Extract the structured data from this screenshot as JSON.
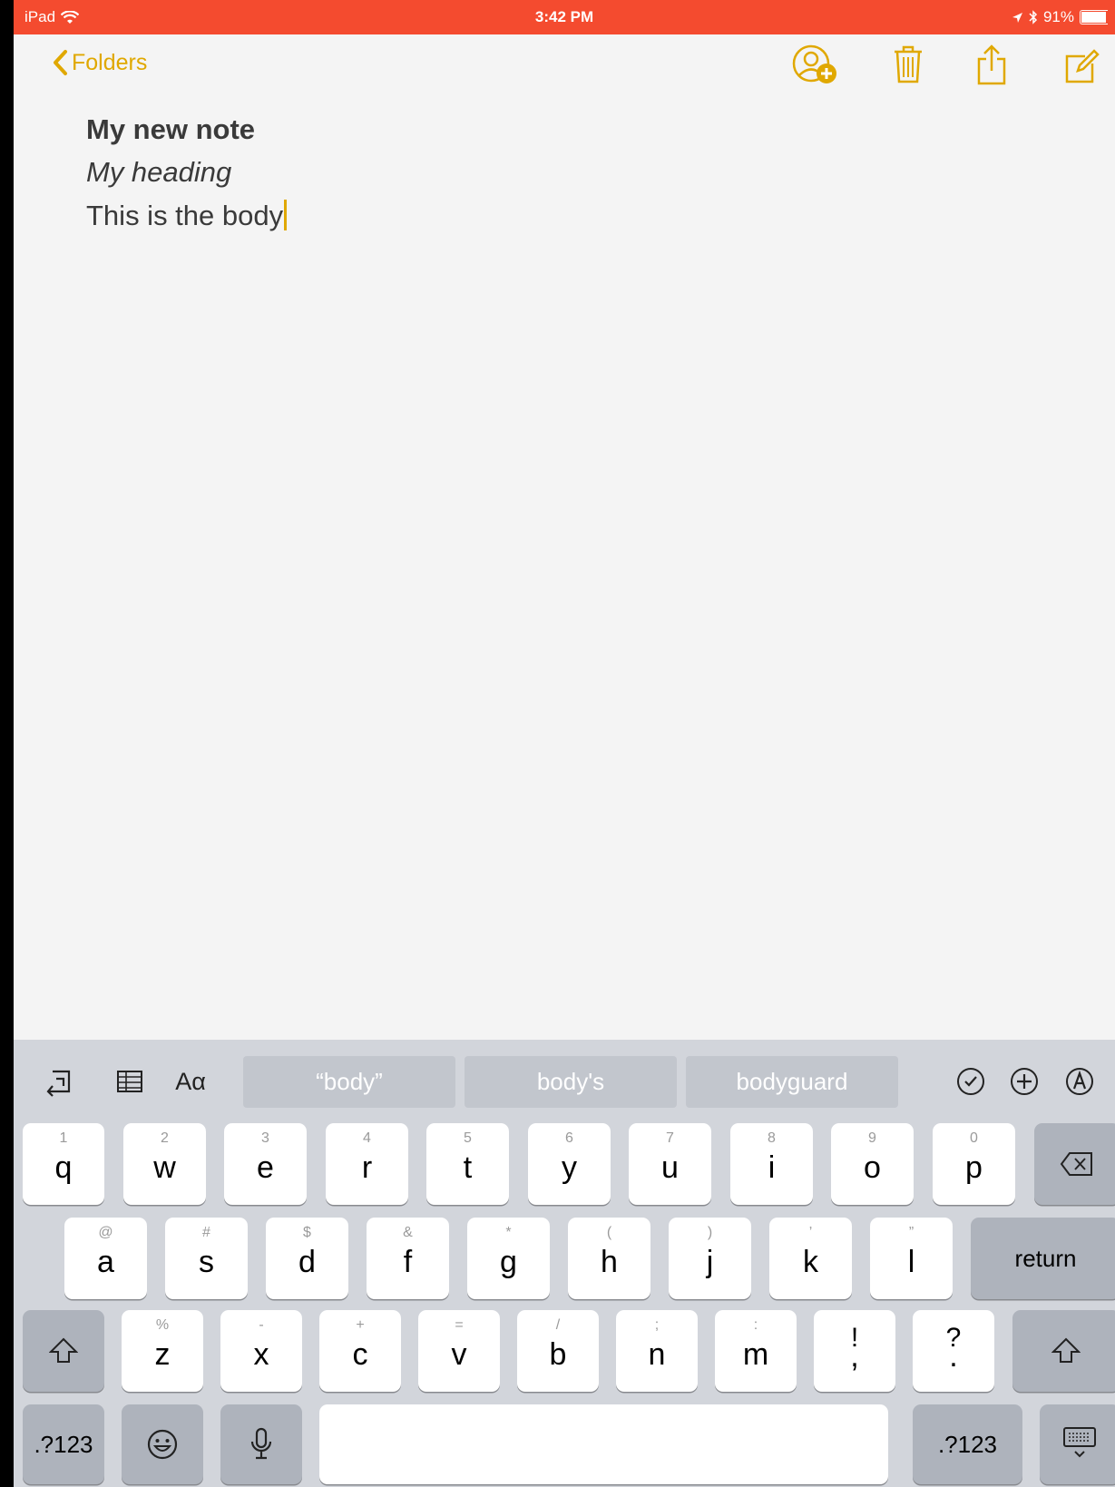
{
  "status_bar": {
    "device": "iPad",
    "time": "3:42 PM",
    "battery": "91%"
  },
  "nav": {
    "back_label": "Folders"
  },
  "note": {
    "title": "My new note",
    "heading": "My heading",
    "body": "This is the body"
  },
  "keyboard": {
    "suggestions": [
      "“body”",
      "body's",
      "bodyguard"
    ],
    "format_label": "Aα",
    "row1": [
      {
        "main": "q",
        "alt": "1"
      },
      {
        "main": "w",
        "alt": "2"
      },
      {
        "main": "e",
        "alt": "3"
      },
      {
        "main": "r",
        "alt": "4"
      },
      {
        "main": "t",
        "alt": "5"
      },
      {
        "main": "y",
        "alt": "6"
      },
      {
        "main": "u",
        "alt": "7"
      },
      {
        "main": "i",
        "alt": "8"
      },
      {
        "main": "o",
        "alt": "9"
      },
      {
        "main": "p",
        "alt": "0"
      }
    ],
    "row2": [
      {
        "main": "a",
        "alt": "@"
      },
      {
        "main": "s",
        "alt": "#"
      },
      {
        "main": "d",
        "alt": "$"
      },
      {
        "main": "f",
        "alt": "&"
      },
      {
        "main": "g",
        "alt": "*"
      },
      {
        "main": "h",
        "alt": "("
      },
      {
        "main": "j",
        "alt": ")"
      },
      {
        "main": "k",
        "alt": "’"
      },
      {
        "main": "l",
        "alt": "”"
      }
    ],
    "row3": [
      {
        "main": "z",
        "alt": "%"
      },
      {
        "main": "x",
        "alt": "-"
      },
      {
        "main": "c",
        "alt": "+"
      },
      {
        "main": "v",
        "alt": "="
      },
      {
        "main": "b",
        "alt": "/"
      },
      {
        "main": "n",
        "alt": ";"
      },
      {
        "main": "m",
        "alt": ":"
      },
      {
        "main": ",",
        "alt": "!"
      },
      {
        "main": ".",
        "alt": "?"
      }
    ],
    "return_label": "return",
    "numbers_label": ".?123"
  },
  "colors": {
    "status_bar": "#f44b2f",
    "accent": "#e0a800",
    "keyboard_bg": "#d2d5db"
  }
}
